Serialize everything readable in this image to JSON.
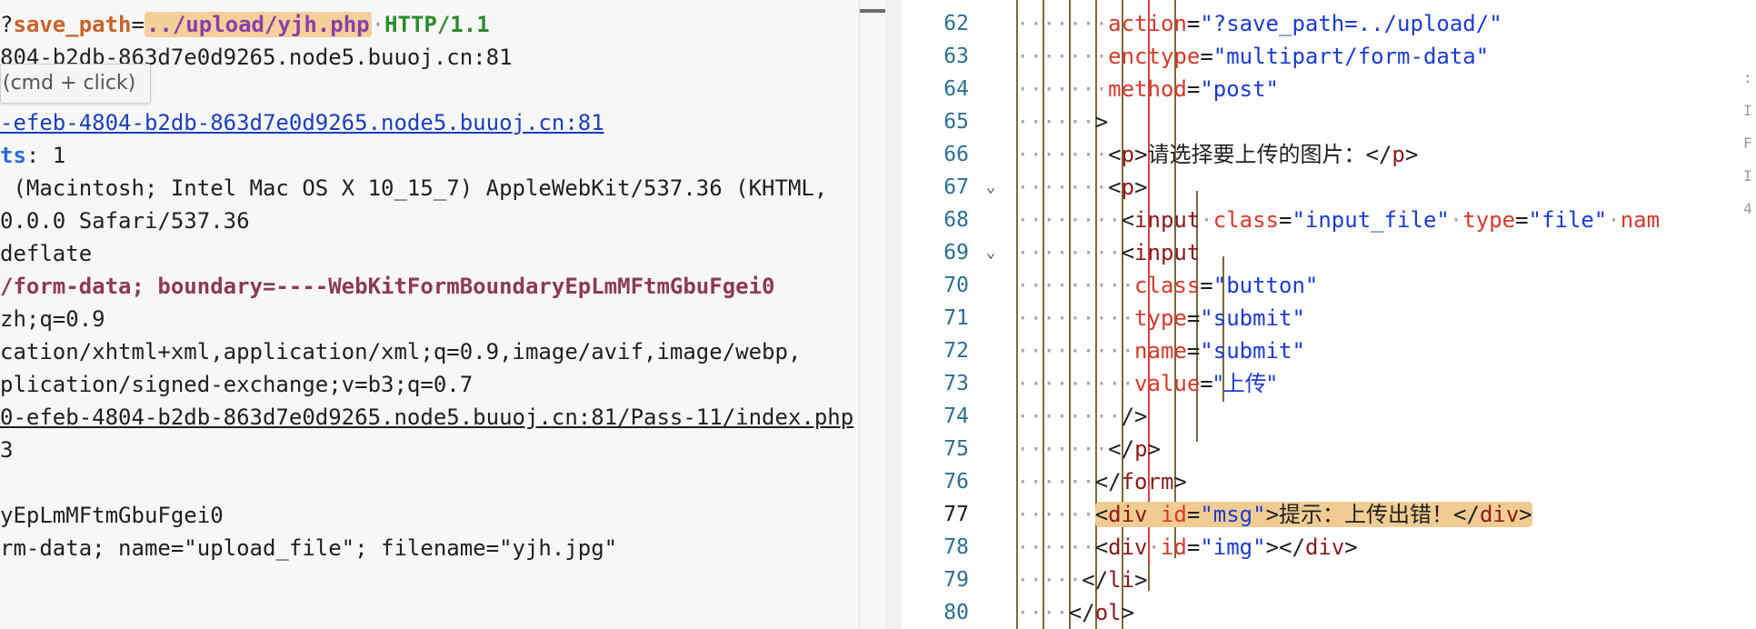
{
  "request": {
    "lines": [
      {
        "id": "l0",
        "prefix": "?",
        "param": "save_path",
        "eq": "=",
        "value": "../upload/yjh.php",
        "sep": " ",
        "proto": "HTTP/1.1"
      },
      {
        "id": "l1",
        "text": "804-b2db-863d7e0d9265.node5.buuoj.cn:81"
      },
      {
        "id": "l2",
        "text": ""
      },
      {
        "id": "l3",
        "text": "-efeb-4804-b2db-863d7e0d9265.node5.buuoj.cn:81"
      },
      {
        "id": "l4",
        "key": "ts",
        "rest": ": 1"
      },
      {
        "id": "l5",
        "text": " (Macintosh; Intel Mac OS X 10_15_7) AppleWebKit/537.36 (KHTML, "
      },
      {
        "id": "l6",
        "text": "0.0.0 Safari/537.36"
      },
      {
        "id": "l7",
        "text": "deflate"
      },
      {
        "id": "l8",
        "text": "/form-data; boundary=----WebKitFormBoundaryEpLmMFtmGbuFgei0"
      },
      {
        "id": "l9",
        "text": "zh;q=0.9"
      },
      {
        "id": "l10",
        "text": "cation/xhtml+xml,application/xml;q=0.9,image/avif,image/webp,"
      },
      {
        "id": "l11",
        "text": "plication/signed-exchange;v=b3;q=0.7"
      },
      {
        "id": "l12",
        "text": "0-efeb-4804-b2db-863d7e0d9265.node5.buuoj.cn:81/Pass-11/index.php"
      },
      {
        "id": "l13",
        "text": "3"
      },
      {
        "id": "l14",
        "text": ""
      },
      {
        "id": "l15",
        "text": "yEpLmMFtmGbuFgei0"
      },
      {
        "id": "l16",
        "text": "rm-data; name=\"upload_file\"; filename=\"yjh.jpg\""
      }
    ],
    "tooltip": "(cmd + click)"
  },
  "editor": {
    "line_numbers": [
      "62",
      "63",
      "64",
      "65",
      "66",
      "67",
      "68",
      "69",
      "70",
      "71",
      "72",
      "73",
      "74",
      "75",
      "76",
      "77",
      "78",
      "79",
      "80"
    ],
    "active_line": "77",
    "folds": {
      "67": "⌄",
      "69": "⌄"
    },
    "code": {
      "l62": {
        "attr": "action",
        "eq": "=",
        "val": "\"?save_path=../upload/\""
      },
      "l63": {
        "attr": "enctype",
        "eq": "=",
        "val": "\"multipart/form-data\""
      },
      "l64": {
        "attr": "method",
        "eq": "=",
        "val": "\"post\""
      },
      "l65": {
        "text": ">"
      },
      "l66": {
        "open": "<",
        "tag": "p",
        "close": ">",
        "content": "请选择要上传的图片：",
        "end_open": "</",
        "end_tag": "p",
        "end_close": ">"
      },
      "l67": {
        "open": "<",
        "tag": "p",
        "close": ">"
      },
      "l68": {
        "open": "<",
        "tag": "input",
        "a1": "class",
        "v1": "\"input_file\"",
        "a2": "type",
        "v2": "\"file\"",
        "a3": "nam"
      },
      "l69": {
        "open": "<",
        "tag": "input"
      },
      "l70": {
        "attr": "class",
        "eq": "=",
        "val": "\"button\""
      },
      "l71": {
        "attr": "type",
        "eq": "=",
        "val": "\"submit\""
      },
      "l72": {
        "attr": "name",
        "eq": "=",
        "val": "\"submit\""
      },
      "l73": {
        "attr": "value",
        "eq": "=",
        "val": "\"上传\""
      },
      "l74": {
        "text": "/>"
      },
      "l75": {
        "open": "</",
        "tag": "p",
        "close": ">"
      },
      "l76": {
        "open": "</",
        "tag": "form",
        "close": ">"
      },
      "l77": {
        "open": "<",
        "tag": "div",
        "attr": "id",
        "eq": "=",
        "val": "\"msg\"",
        "close": ">",
        "content": "提示：上传出错！",
        "end_open": "</",
        "end_tag": "div",
        "end_close": ">"
      },
      "l78": {
        "open": "<",
        "tag": "div",
        "attr": "id",
        "eq": "=",
        "val": "\"img\"",
        "close": "></",
        "end_tag": "div",
        "end_close": ">"
      },
      "l79": {
        "open": "</",
        "tag": "li",
        "close": ">"
      },
      "l80": {
        "open": "</",
        "tag": "ol",
        "close": ">"
      }
    },
    "edge_glyphs": [
      "",
      ":",
      "I",
      "F",
      "I",
      "4"
    ]
  },
  "colors": {
    "highlight": "#f0cc93",
    "line_number": "#2a6f90",
    "attribute": "#d43a2b",
    "string": "#1b3bd1",
    "tag": "#8b1a1a"
  }
}
